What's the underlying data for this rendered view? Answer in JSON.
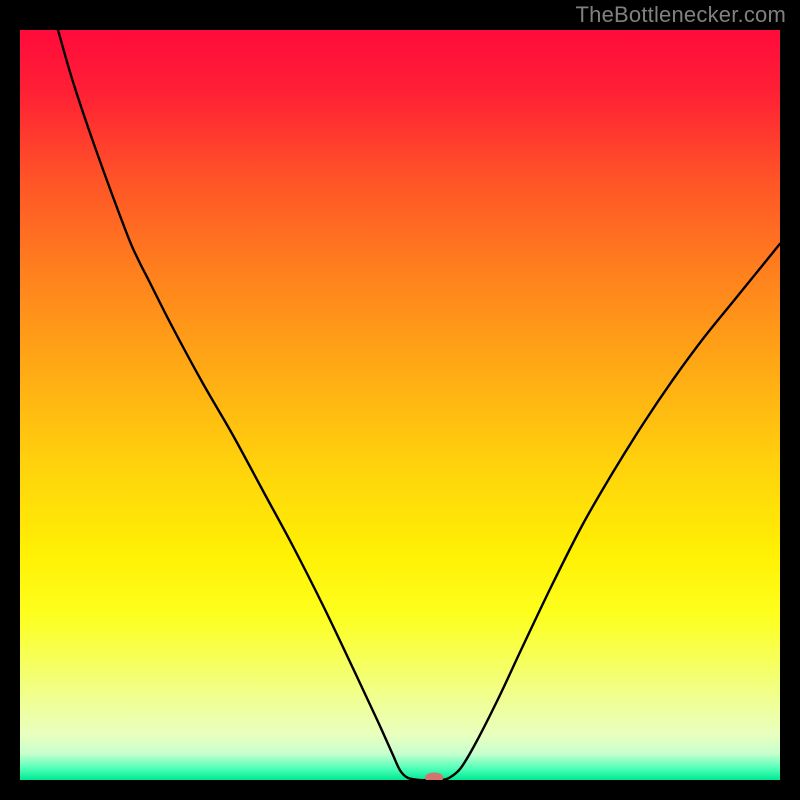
{
  "watermark": "TheBottlenecker.com",
  "chart_data": {
    "type": "line",
    "title": "",
    "xlabel": "",
    "ylabel": "",
    "xlim": [
      0,
      100
    ],
    "ylim": [
      0,
      100
    ],
    "background_gradient": {
      "stops": [
        {
          "offset": 0.0,
          "color": "#ff0b3b"
        },
        {
          "offset": 0.08,
          "color": "#ff1f35"
        },
        {
          "offset": 0.2,
          "color": "#ff5427"
        },
        {
          "offset": 0.32,
          "color": "#ff7f1e"
        },
        {
          "offset": 0.45,
          "color": "#ffa915"
        },
        {
          "offset": 0.58,
          "color": "#ffd20c"
        },
        {
          "offset": 0.7,
          "color": "#fff104"
        },
        {
          "offset": 0.78,
          "color": "#fdff1e"
        },
        {
          "offset": 0.84,
          "color": "#f6ff5a"
        },
        {
          "offset": 0.9,
          "color": "#efff9a"
        },
        {
          "offset": 0.94,
          "color": "#e8ffbf"
        },
        {
          "offset": 0.965,
          "color": "#c7ffce"
        },
        {
          "offset": 0.985,
          "color": "#4dffb8"
        },
        {
          "offset": 1.0,
          "color": "#00e893"
        }
      ]
    },
    "series": [
      {
        "name": "bottleneck-curve",
        "color": "#000000",
        "width": 2.4,
        "points": [
          {
            "x": 5.0,
            "y": 100.0
          },
          {
            "x": 7.0,
            "y": 93.0
          },
          {
            "x": 10.0,
            "y": 84.0
          },
          {
            "x": 14.0,
            "y": 73.0
          },
          {
            "x": 15.5,
            "y": 69.5
          },
          {
            "x": 17.0,
            "y": 66.5
          },
          {
            "x": 20.0,
            "y": 60.5
          },
          {
            "x": 24.0,
            "y": 53.0
          },
          {
            "x": 28.0,
            "y": 46.0
          },
          {
            "x": 32.0,
            "y": 38.5
          },
          {
            "x": 36.0,
            "y": 31.0
          },
          {
            "x": 40.0,
            "y": 23.0
          },
          {
            "x": 44.0,
            "y": 14.5
          },
          {
            "x": 47.0,
            "y": 8.0
          },
          {
            "x": 49.0,
            "y": 3.5
          },
          {
            "x": 50.0,
            "y": 1.3
          },
          {
            "x": 51.0,
            "y": 0.3
          },
          {
            "x": 52.5,
            "y": 0.0
          },
          {
            "x": 54.0,
            "y": 0.0
          },
          {
            "x": 55.5,
            "y": 0.0
          },
          {
            "x": 56.5,
            "y": 0.3
          },
          {
            "x": 58.0,
            "y": 1.6
          },
          {
            "x": 60.0,
            "y": 5.0
          },
          {
            "x": 63.0,
            "y": 11.0
          },
          {
            "x": 66.0,
            "y": 17.5
          },
          {
            "x": 70.0,
            "y": 26.0
          },
          {
            "x": 74.0,
            "y": 34.0
          },
          {
            "x": 78.0,
            "y": 41.0
          },
          {
            "x": 82.0,
            "y": 47.5
          },
          {
            "x": 86.0,
            "y": 53.5
          },
          {
            "x": 90.0,
            "y": 59.0
          },
          {
            "x": 94.0,
            "y": 64.0
          },
          {
            "x": 98.0,
            "y": 69.0
          },
          {
            "x": 100.0,
            "y": 71.5
          }
        ]
      }
    ],
    "marker": {
      "name": "optimal-point",
      "x": 54.5,
      "y": 0.3,
      "rx": 1.2,
      "ry": 0.7,
      "color": "#d4746e"
    }
  }
}
